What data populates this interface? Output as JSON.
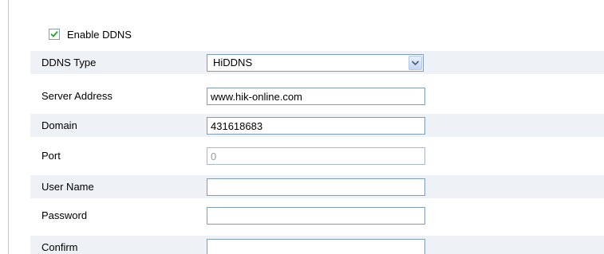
{
  "enable_ddns": {
    "label": "Enable DDNS",
    "checked": true
  },
  "fields": {
    "ddns_type": {
      "label": "DDNS Type",
      "value": "HiDDNS"
    },
    "server_address": {
      "label": "Server Address",
      "value": "www.hik-online.com"
    },
    "domain": {
      "label": "Domain",
      "value": "431618683"
    },
    "port": {
      "label": "Port",
      "value": "0"
    },
    "user_name": {
      "label": "User Name",
      "value": ""
    },
    "password": {
      "label": "Password",
      "value": ""
    },
    "confirm": {
      "label": "Confirm",
      "value": ""
    }
  },
  "colors": {
    "row_shade": "#eef1f5",
    "field_border": "#7f9db9",
    "check_green": "#21a121"
  },
  "icons": {
    "checkbox_mark": "checkmark-icon",
    "select_arrow": "chevron-down-icon"
  }
}
